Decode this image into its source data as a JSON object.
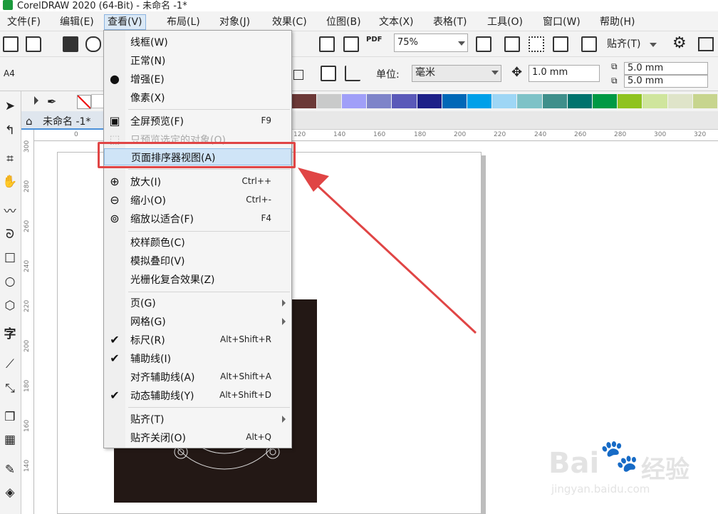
{
  "app": {
    "title": "CorelDRAW 2020 (64-Bit) - 未命名 -1*"
  },
  "menubar": {
    "items": [
      {
        "label": "文件(F)"
      },
      {
        "label": "编辑(E)"
      },
      {
        "label": "查看(V)"
      },
      {
        "label": "布局(L)"
      },
      {
        "label": "对象(J)"
      },
      {
        "label": "效果(C)"
      },
      {
        "label": "位图(B)"
      },
      {
        "label": "文本(X)"
      },
      {
        "label": "表格(T)"
      },
      {
        "label": "工具(O)"
      },
      {
        "label": "窗口(W)"
      },
      {
        "label": "帮助(H)"
      }
    ],
    "active_index": 2
  },
  "toolbar": {
    "zoom_value": "75%",
    "pdf_label": "PDF",
    "snap_label": "贴齐(T)"
  },
  "property_bar": {
    "page_size": "A4",
    "unit_label": "单位:",
    "unit_value": "毫米",
    "nudge_value": "1.0 mm",
    "dup_x": "5.0 mm",
    "dup_y": "5.0 mm"
  },
  "document_tab": {
    "label": "未命名 -1*"
  },
  "hruler": {
    "ticks": [
      "0",
      "120",
      "140",
      "160",
      "180",
      "200",
      "220",
      "240",
      "260",
      "280",
      "300",
      "320"
    ]
  },
  "vruler": {
    "ticks": [
      "300",
      "280",
      "260",
      "240",
      "220",
      "200",
      "180",
      "160",
      "140"
    ]
  },
  "view_menu": {
    "items": [
      {
        "label": "线框(W)",
        "shortcut": "",
        "icon": ""
      },
      {
        "label": "正常(N)",
        "shortcut": "",
        "icon": ""
      },
      {
        "label": "增强(E)",
        "shortcut": "",
        "icon": "bullet-icon"
      },
      {
        "label": "像素(X)",
        "shortcut": "",
        "icon": ""
      },
      {
        "label": "全屏预览(F)",
        "shortcut": "F9",
        "icon": "fullscreen-icon"
      },
      {
        "label": "只预览选定的对象(O)",
        "shortcut": "",
        "icon": "preview-selected-icon",
        "disabled": true
      },
      {
        "label": "页面排序器视图(A)",
        "shortcut": "",
        "icon": "",
        "highlighted": true
      },
      {
        "label": "放大(I)",
        "shortcut": "Ctrl++",
        "icon": "zoom-in-icon"
      },
      {
        "label": "缩小(O)",
        "shortcut": "Ctrl+-",
        "icon": "zoom-out-icon"
      },
      {
        "label": "缩放以适合(F)",
        "shortcut": "F4",
        "icon": "zoom-fit-icon"
      },
      {
        "label": "校样颜色(C)",
        "shortcut": "",
        "icon": ""
      },
      {
        "label": "模拟叠印(V)",
        "shortcut": "",
        "icon": ""
      },
      {
        "label": "光栅化复合效果(Z)",
        "shortcut": "",
        "icon": ""
      },
      {
        "label": "页(G)",
        "shortcut": "",
        "icon": "",
        "submenu": true
      },
      {
        "label": "网格(G)",
        "shortcut": "",
        "icon": "",
        "submenu": true
      },
      {
        "label": "标尺(R)",
        "shortcut": "Alt+Shift+R",
        "icon": "check-icon"
      },
      {
        "label": "辅助线(I)",
        "shortcut": "",
        "icon": "check-icon"
      },
      {
        "label": "对齐辅助线(A)",
        "shortcut": "Alt+Shift+A",
        "icon": ""
      },
      {
        "label": "动态辅助线(Y)",
        "shortcut": "Alt+Shift+D",
        "icon": "check-icon"
      },
      {
        "label": "贴齐(T)",
        "shortcut": "",
        "icon": "",
        "submenu": true
      },
      {
        "label": "贴齐关闭(O)",
        "shortcut": "Alt+Q",
        "icon": ""
      }
    ]
  },
  "palette": {
    "colors": [
      "#ffffff",
      "#000000",
      "#e60012",
      "#fff100",
      "#920783",
      "#e4007f",
      "#f39800",
      "#f19ec2",
      "#6b3836",
      "#c9caca",
      "#a09ff8",
      "#7e84c9",
      "#5a59b9",
      "#1d2088",
      "#0068b7",
      "#00a0e9",
      "#9ed6f5",
      "#7ec2c7",
      "#3f8f8b",
      "#00736d",
      "#009944",
      "#8fc31f",
      "#cfe59d",
      "#dfe4c9",
      "#c7d58e"
    ]
  },
  "watermark": {
    "brand": "Bai",
    "brand2": "经验",
    "url": "jingyan.baidu.com"
  }
}
